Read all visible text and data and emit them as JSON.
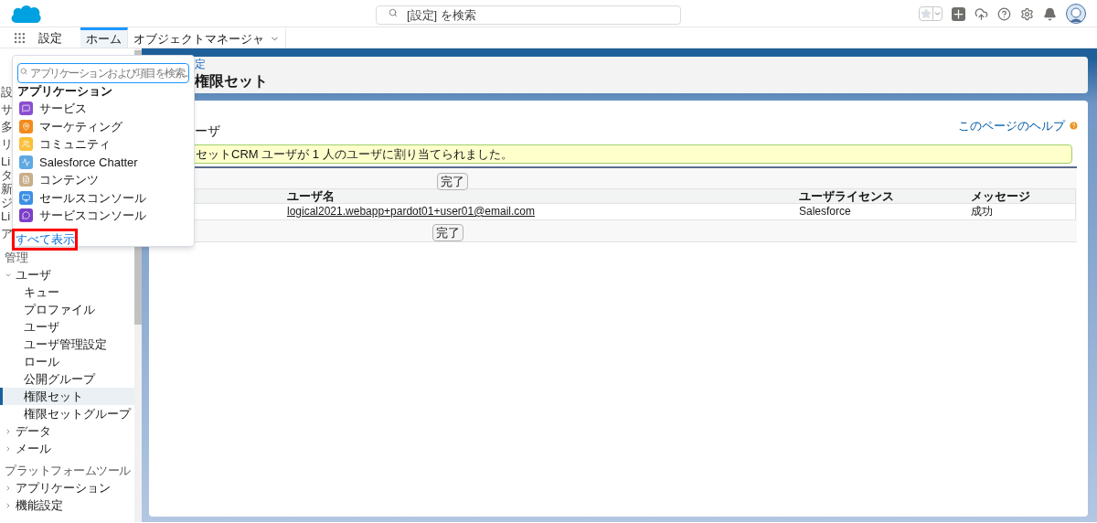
{
  "header": {
    "search": {
      "placeholder": "[設定] を検索"
    }
  },
  "nav": {
    "app_title": "設定",
    "tabs": [
      {
        "label": "ホーム",
        "selected": true,
        "menu": false
      },
      {
        "label": "オブジェクトマネージャ",
        "selected": false,
        "menu": true
      }
    ]
  },
  "sidebar": {
    "partial_items": [
      [
        "設"
      ],
      [
        "サ"
      ],
      [
        "多"
      ],
      [
        "リ"
      ],
      [
        "Li",
        "タ"
      ],
      [
        "新",
        "ジ"
      ],
      [
        "Li"
      ],
      [
        "ア"
      ]
    ],
    "sections": [
      {
        "title": "管理",
        "items": [
          {
            "label": "ユーザ",
            "expanded": true,
            "children": [
              {
                "label": "キュー",
                "selected": false
              },
              {
                "label": "プロファイル",
                "selected": false
              },
              {
                "label": "ユーザ",
                "selected": false
              },
              {
                "label": "ユーザ管理設定",
                "selected": false
              },
              {
                "label": "ロール",
                "selected": false
              },
              {
                "label": "公開グループ",
                "selected": false
              },
              {
                "label": "権限セット",
                "selected": true
              },
              {
                "label": "権限セットグループ",
                "selected": false
              }
            ]
          },
          {
            "label": "データ",
            "expanded": false
          },
          {
            "label": "メール",
            "expanded": false
          }
        ]
      },
      {
        "title": "プラットフォームツール",
        "items": [
          {
            "label": "アプリケーション",
            "expanded": false
          },
          {
            "label": "機能設定",
            "expanded": false
          }
        ]
      }
    ]
  },
  "app_menu": {
    "search": {
      "placeholder": "アプリケーションおよび項目を検索..."
    },
    "heading": "アプリケーション",
    "apps": [
      {
        "label": "サービス",
        "color": "#8a4fcf",
        "kind": "service"
      },
      {
        "label": "マーケティング",
        "color": "#f08c1e",
        "kind": "marketing"
      },
      {
        "label": "コミュニティ",
        "color": "#fbbf3a",
        "kind": "community"
      },
      {
        "label": "Salesforce Chatter",
        "color": "#5fa9e3",
        "kind": "chatter"
      },
      {
        "label": "コンテンツ",
        "color": "#c8ae8a",
        "kind": "content"
      },
      {
        "label": "セールスコンソール",
        "color": "#3b8fe5",
        "kind": "console"
      },
      {
        "label": "サービスコンソール",
        "color": "#7b3fc8",
        "kind": "service-console"
      }
    ],
    "view_all": {
      "label": "すべて表示",
      "highlighted": true
    }
  },
  "page_header": {
    "breadcrumb": "定",
    "title": "権限セット"
  },
  "panel": {
    "title": "ーザ",
    "help_link": "このページのヘルプ",
    "message": "セットCRM ユーザが 1 人のユーザに割り当てられました。",
    "buttons": [
      "完了",
      "完了"
    ],
    "table": {
      "columns": [
        "ユーザ名",
        "ユーザライセンス",
        "メッセージ"
      ],
      "rows": [
        [
          "logical2021.webapp+pardot01+user01@email.com",
          "Salesforce",
          "成功"
        ]
      ]
    }
  }
}
